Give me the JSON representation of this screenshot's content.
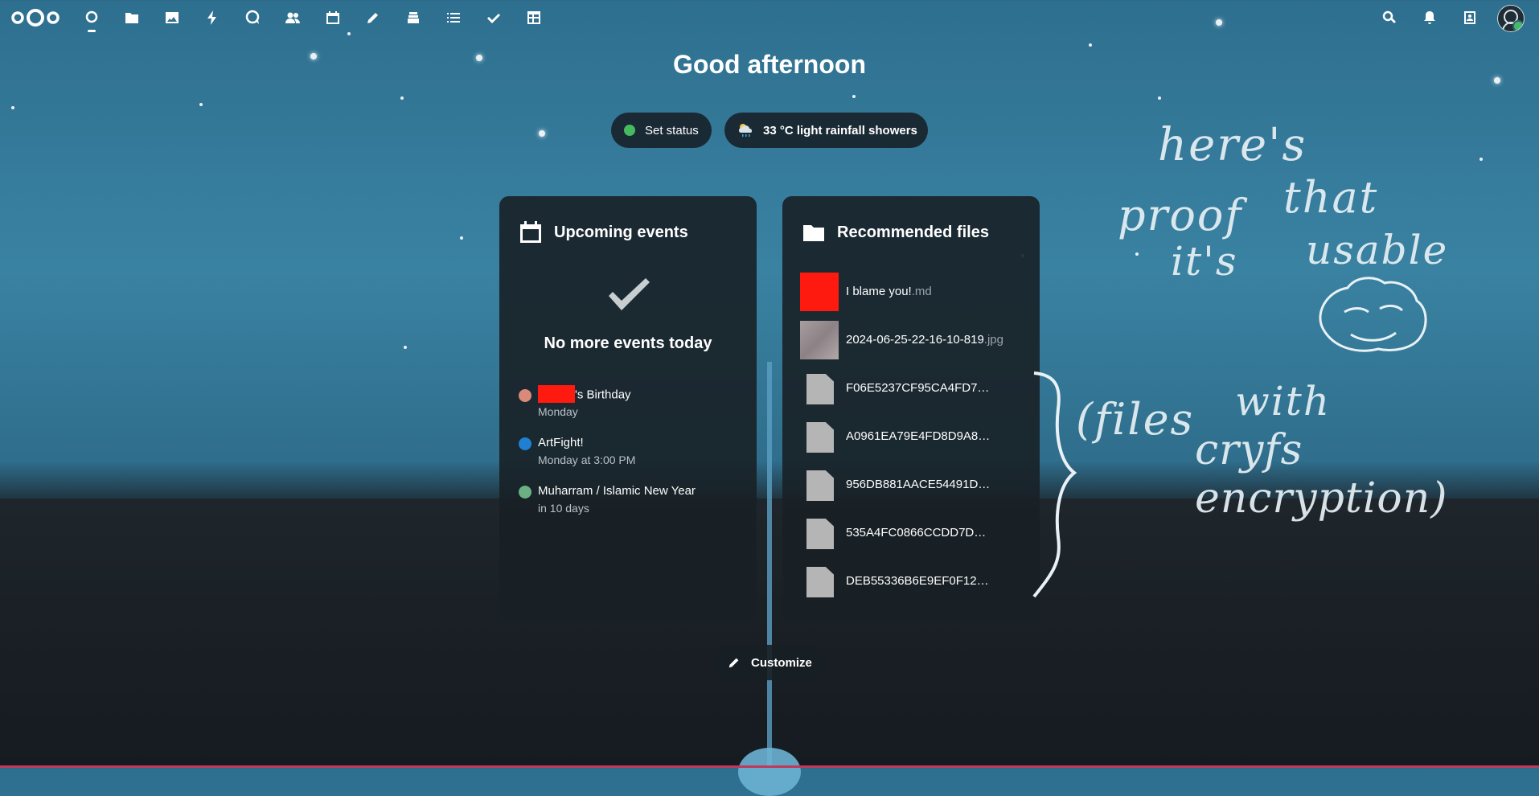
{
  "topbar": {
    "apps": [
      {
        "name": "dashboard",
        "icon": "dashboard-icon"
      },
      {
        "name": "files",
        "icon": "folder-icon"
      },
      {
        "name": "photos",
        "icon": "image-icon"
      },
      {
        "name": "activity",
        "icon": "lightning-icon"
      },
      {
        "name": "talk",
        "icon": "chat-icon"
      },
      {
        "name": "contacts",
        "icon": "contacts-icon"
      },
      {
        "name": "calendar",
        "icon": "calendar-icon"
      },
      {
        "name": "notes",
        "icon": "pencil-icon"
      },
      {
        "name": "deck",
        "icon": "stack-icon"
      },
      {
        "name": "tasks",
        "icon": "list-icon"
      },
      {
        "name": "checks",
        "icon": "check-icon"
      },
      {
        "name": "tables",
        "icon": "table-icon"
      }
    ],
    "right_icons": [
      "search-icon",
      "bell-icon",
      "contacts-menu-icon"
    ]
  },
  "greeting": "Good afternoon",
  "status": {
    "label": "Set status",
    "color": "#46ba61"
  },
  "weather": {
    "label": "33 °C light rainfall showers",
    "icon": "rain-cloud-icon"
  },
  "events_panel": {
    "title": "Upcoming events",
    "empty_message": "No more events today",
    "events": [
      {
        "name": "'s Birthday",
        "when": "Monday",
        "color": "#d98a7a",
        "redacted_prefix": true
      },
      {
        "name": "ArtFight!",
        "when": "Monday at 3:00 PM",
        "color": "#1f7fd1",
        "redacted_prefix": false
      },
      {
        "name": "Muharram / Islamic New Year",
        "when": "in 10 days",
        "color": "#6ab083",
        "redacted_prefix": false
      }
    ]
  },
  "files_panel": {
    "title": "Recommended files",
    "files": [
      {
        "name": "I blame you!",
        "ext": ".md",
        "thumb": "red"
      },
      {
        "name": "2024-06-25-22-16-10-819",
        "ext": ".jpg",
        "thumb": "photo"
      },
      {
        "name": "F06E5237CF95CA4FD7…",
        "ext": "",
        "thumb": "doc"
      },
      {
        "name": "A0961EA79E4FD8D9A8…",
        "ext": "",
        "thumb": "doc"
      },
      {
        "name": "956DB881AACE54491D…",
        "ext": "",
        "thumb": "doc"
      },
      {
        "name": "535A4FC0866CCDD7D…",
        "ext": "",
        "thumb": "doc"
      },
      {
        "name": "DEB55336B6E9EF0F12…",
        "ext": "",
        "thumb": "doc"
      }
    ]
  },
  "customize_label": "Customize",
  "annotation": {
    "line1": "here's",
    "line2a": "proof",
    "line2b": "that",
    "line3a": "it's",
    "line3b": "usable",
    "line4a": "(files",
    "line4b": "with",
    "line5": "cryfs encryption)"
  }
}
